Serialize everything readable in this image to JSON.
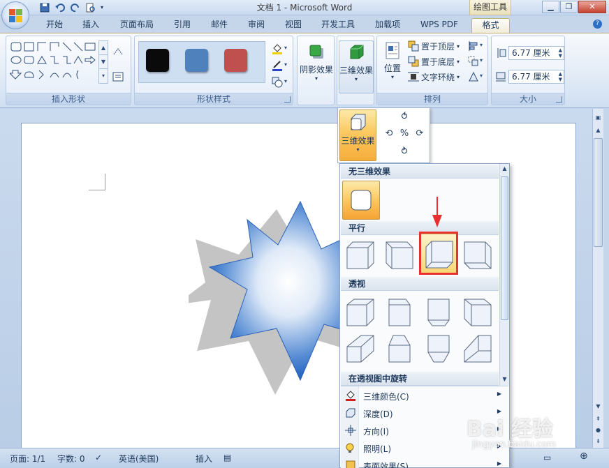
{
  "window": {
    "title": "文档 1 - Microsoft Word",
    "contextual_tab_group": "绘图工具",
    "minimize": "▁",
    "restore": "❐",
    "close": "✕"
  },
  "ribbon_tabs": [
    {
      "label": "开始"
    },
    {
      "label": "插入"
    },
    {
      "label": "页面布局"
    },
    {
      "label": "引用"
    },
    {
      "label": "邮件"
    },
    {
      "label": "审阅"
    },
    {
      "label": "视图"
    },
    {
      "label": "开发工具"
    },
    {
      "label": "加载项"
    },
    {
      "label": "WPS PDF"
    },
    {
      "label": "格式",
      "active": true
    }
  ],
  "help": "?",
  "groups": {
    "insert_shapes": {
      "label": "插入形状"
    },
    "shape_styles": {
      "label": "形状样式",
      "swatches": [
        "#0a0a0a",
        "#4f81bd",
        "#c0504d"
      ]
    },
    "shadow": {
      "label": "阴影效果"
    },
    "three_d": {
      "label": "三维效果"
    },
    "arrange": {
      "label": "排列",
      "position": "位置",
      "bring_to_front": "置于顶层",
      "send_to_back": "置于底层",
      "text_wrap": "文字环绕"
    },
    "size": {
      "label": "大小",
      "height": "6.77 厘米",
      "width": "6.77 厘米"
    }
  },
  "effect_dropdown": {
    "label": "三维效果"
  },
  "gallery": {
    "sections": {
      "none": "无三维效果",
      "parallel": "平行",
      "perspective": "透视",
      "rotation": "在透视图中旋转"
    },
    "menu_items": [
      {
        "label": "三维颜色(C)",
        "icon": "paint-bucket-icon"
      },
      {
        "label": "深度(D)",
        "icon": "depth-icon"
      },
      {
        "label": "方向(I)",
        "icon": "direction-icon"
      },
      {
        "label": "照明(L)",
        "icon": "lighting-icon"
      },
      {
        "label": "表面效果(S)",
        "icon": "surface-icon"
      }
    ]
  },
  "statusbar": {
    "page": "页面: 1/1",
    "words": "字数: 0",
    "language": "英语(美国)",
    "mode": "插入"
  },
  "watermark": {
    "brand": "Bai  经验",
    "sub": "jingyan.baidu.com"
  },
  "colors": {
    "accent": "#fbc85f",
    "highlight": "#e83030",
    "ribbon": "#dde8f5"
  }
}
